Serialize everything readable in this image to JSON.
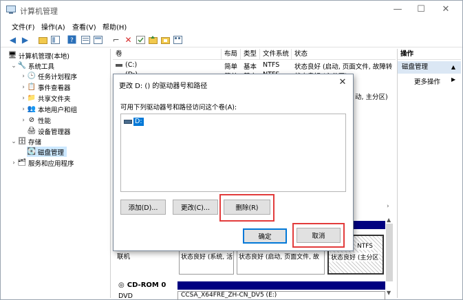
{
  "window": {
    "title": "计算机管理"
  },
  "window_controls": {
    "minimize": "—",
    "maximize": "☐",
    "close": "✕"
  },
  "menu": [
    "文件(F)",
    "操作(A)",
    "查看(V)",
    "帮助(H)"
  ],
  "tree": {
    "root": "计算机管理(本地)",
    "system_tools": "系统工具",
    "task_scheduler": "任务计划程序",
    "event_viewer": "事件查看器",
    "shared_folders": "共享文件夹",
    "local_users": "本地用户和组",
    "performance": "性能",
    "device_manager": "设备管理器",
    "storage": "存储",
    "disk_management": "磁盘管理",
    "services": "服务和应用程序"
  },
  "volume_list": {
    "columns": [
      "卷",
      "布局",
      "类型",
      "文件系统",
      "状态"
    ],
    "rows": [
      {
        "volume": "(C:)",
        "layout": "简单",
        "type": "基本",
        "fs": "NTFS",
        "status": "状态良好 (启动, 页面文件, 故障转"
      },
      {
        "volume": "(D:)",
        "layout": "简单",
        "type": "基本",
        "fs": "NTFS",
        "status": "状态良好 (主分区)"
      }
    ],
    "partial_status": "动, 主分区)"
  },
  "actions": {
    "header": "操作",
    "section": "磁盘管理",
    "more": "更多操作"
  },
  "disk_map": {
    "online_label": "联机",
    "seg1_status": "状态良好 (系统, 活",
    "seg2_status": "状态良好 (启动, 页面文件, 故",
    "seg3_fs": "NTFS",
    "seg3_status": "状态良好 (主分区",
    "cdrom_label": "CD-ROM 0",
    "dvd_label": "DVD",
    "cdrom_volume": "CCSA_X64FRE_ZH-CN_DV5 (E:)"
  },
  "dialog": {
    "title": "更改 D: () 的驱动器号和路径",
    "close": "✕",
    "prompt": "可用下列驱动器号和路径访问这个卷(A):",
    "list_item": "D:",
    "add": "添加(D)...",
    "change": "更改(C)...",
    "remove": "删除(R)",
    "ok": "确定",
    "cancel": "取消"
  },
  "colors": {
    "highlight": "#e23b3b",
    "selection": "#0078d7",
    "tree_selected": "#cce8ff",
    "cdrom_bar": "#000080"
  }
}
